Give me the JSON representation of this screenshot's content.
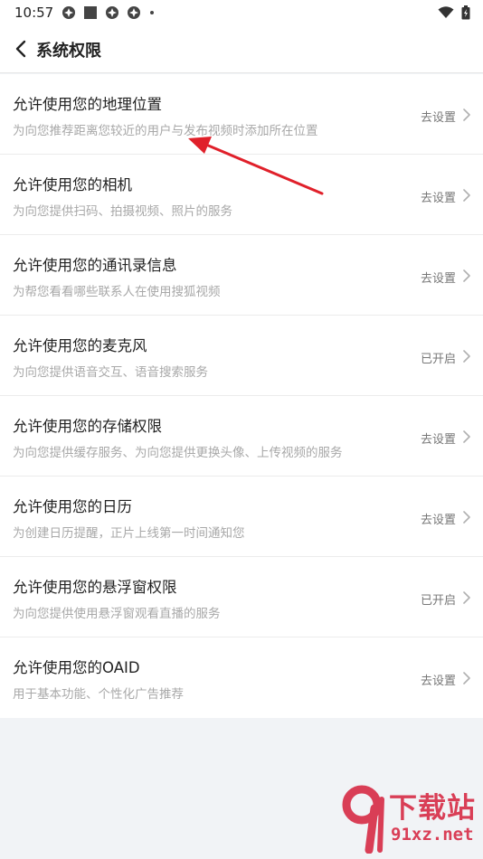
{
  "status_bar": {
    "time": "10:57"
  },
  "header": {
    "title": "系统权限"
  },
  "permissions": [
    {
      "title": "允许使用您的地理位置",
      "desc": "为向您推荐距离您较近的用户与发布视频时添加所在位置",
      "status": "去设置"
    },
    {
      "title": "允许使用您的相机",
      "desc": "为向您提供扫码、拍摄视频、照片的服务",
      "status": "去设置"
    },
    {
      "title": "允许使用您的通讯录信息",
      "desc": "为帮您看看哪些联系人在使用搜狐视频",
      "status": "去设置"
    },
    {
      "title": "允许使用您的麦克风",
      "desc": "为向您提供语音交互、语音搜索服务",
      "status": "已开启"
    },
    {
      "title": "允许使用您的存储权限",
      "desc": "为向您提供缓存服务、为向您提供更换头像、上传视频的服务",
      "status": "去设置"
    },
    {
      "title": "允许使用您的日历",
      "desc": "为创建日历提醒，正片上线第一时间通知您",
      "status": "去设置"
    },
    {
      "title": "允许使用您的悬浮窗权限",
      "desc": "为向您提供使用悬浮窗观看直播的服务",
      "status": "已开启"
    },
    {
      "title": "允许使用您的OAID",
      "desc": "用于基本功能、个性化广告推荐",
      "status": "去设置"
    }
  ],
  "watermark": {
    "brand": "下载站",
    "domain": "91xz.net"
  },
  "colors": {
    "arrow": "#e0202a",
    "watermark": "#d93e56"
  }
}
